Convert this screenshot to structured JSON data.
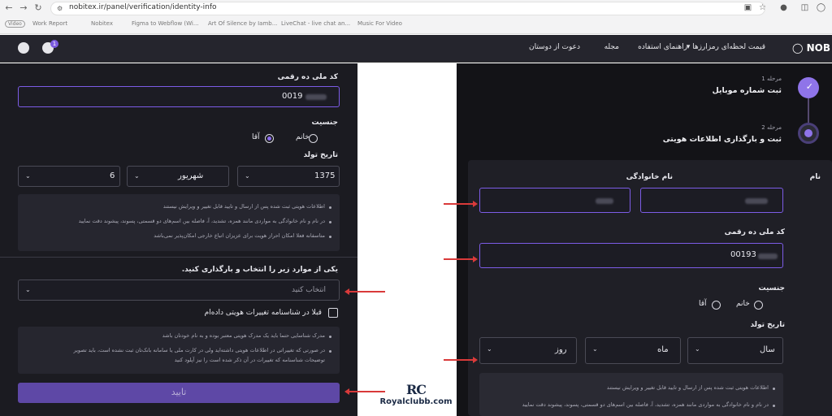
{
  "browser": {
    "url": "nobitex.ir/panel/verification/identity-info",
    "bookmarks": [
      "Video",
      "Work Report",
      "Nobitex",
      "Figma to Webflow (Wi...",
      "Art Of Silence by Iamb...",
      "LiveChat - live chat an...",
      "Music For Video"
    ]
  },
  "appbar": {
    "logo": "NOB",
    "nav": [
      "قیمت لحظه‌ای رمزارزها",
      "راهنمای استفاده",
      "مجله",
      "دعوت از دوستان"
    ],
    "notification_count": "1"
  },
  "left_form": {
    "national_code_label": "کد ملی ده رقمی",
    "national_code_value": "0019",
    "gender_label": "جنسیت",
    "gender_options": [
      "خانم",
      "آقا"
    ],
    "gender_selected": "آقا",
    "birth_label": "تاریخ تولد",
    "birth_year": "1375",
    "birth_month": "شهریور",
    "birth_day": "6",
    "notes": [
      "اطلاعات هویتی ثبت شده پس از ارسال و تایید قابل تغییر و ویرایش نیستند",
      "در نام و نام خانوادگی به مواردی مانند همزه، تشدید، آ، فاصله بین اسم‌های دو قسمتی، پسوند، پیشوند دقت نمایید",
      "متاسفانه فعلا امکان احراز هویت برای عزیزان اتباع خارجی امکان‌پذیر نمی‌باشد"
    ],
    "doc_select_label": "یکی از موارد زیر را انتخاب و بارگذاری کنید.",
    "doc_select_placeholder": "انتخاب کنید",
    "checkbox_label": "قبلا در شناسنامه تغییرات هویتی داده‌ام",
    "doc_notes": [
      "مدرک شناسایی حتما باید یک مدرک هویتی معتبر بوده و به نام خودتان باشد",
      "در صورتی که تغییراتی در اطلاعات هویتی داشته‌اید ولی در کارت ملی یا سامانه بانک‌تان ثبت نشده است، باید تصویر",
      "توضیحات شناسنامه که تغییرات در آن ذکر شده است را نیز آپلود کنید"
    ],
    "submit_label": "تایید"
  },
  "right_form": {
    "step1_small": "مرحله 1",
    "step1_title": "ثبت شماره موبایل",
    "step2_small": "مرحله 2",
    "step2_title": "ثبت و بارگذاری اطلاعات هویتی",
    "first_name_label": "نام",
    "last_name_label": "نام خانوادگی",
    "national_code_label": "کد ملی ده رقمی",
    "national_code_value": "00193",
    "gender_label": "جنسیت",
    "gender_options": [
      "خانم",
      "آقا"
    ],
    "birth_label": "تاریخ تولد",
    "birth_year_placeholder": "سال",
    "birth_month_placeholder": "ماه",
    "birth_day_placeholder": "روز",
    "notes": [
      "اطلاعات هویتی ثبت شده پس از ارسال و تایید قابل تغییر و ویرایش نیستند",
      "در نام و نام خانوادگی به مواردی مانند همزه، تشدید، آ، فاصله بین اسم‌های دو قسمتی، پسوند، پیشوند دقت نمایید"
    ]
  },
  "watermark": {
    "logo": "RC",
    "text": "Royalclubb.com"
  },
  "colors": {
    "accent": "#7c5ce6",
    "arrow": "#d93a3a",
    "panel": "#1b1b21"
  }
}
